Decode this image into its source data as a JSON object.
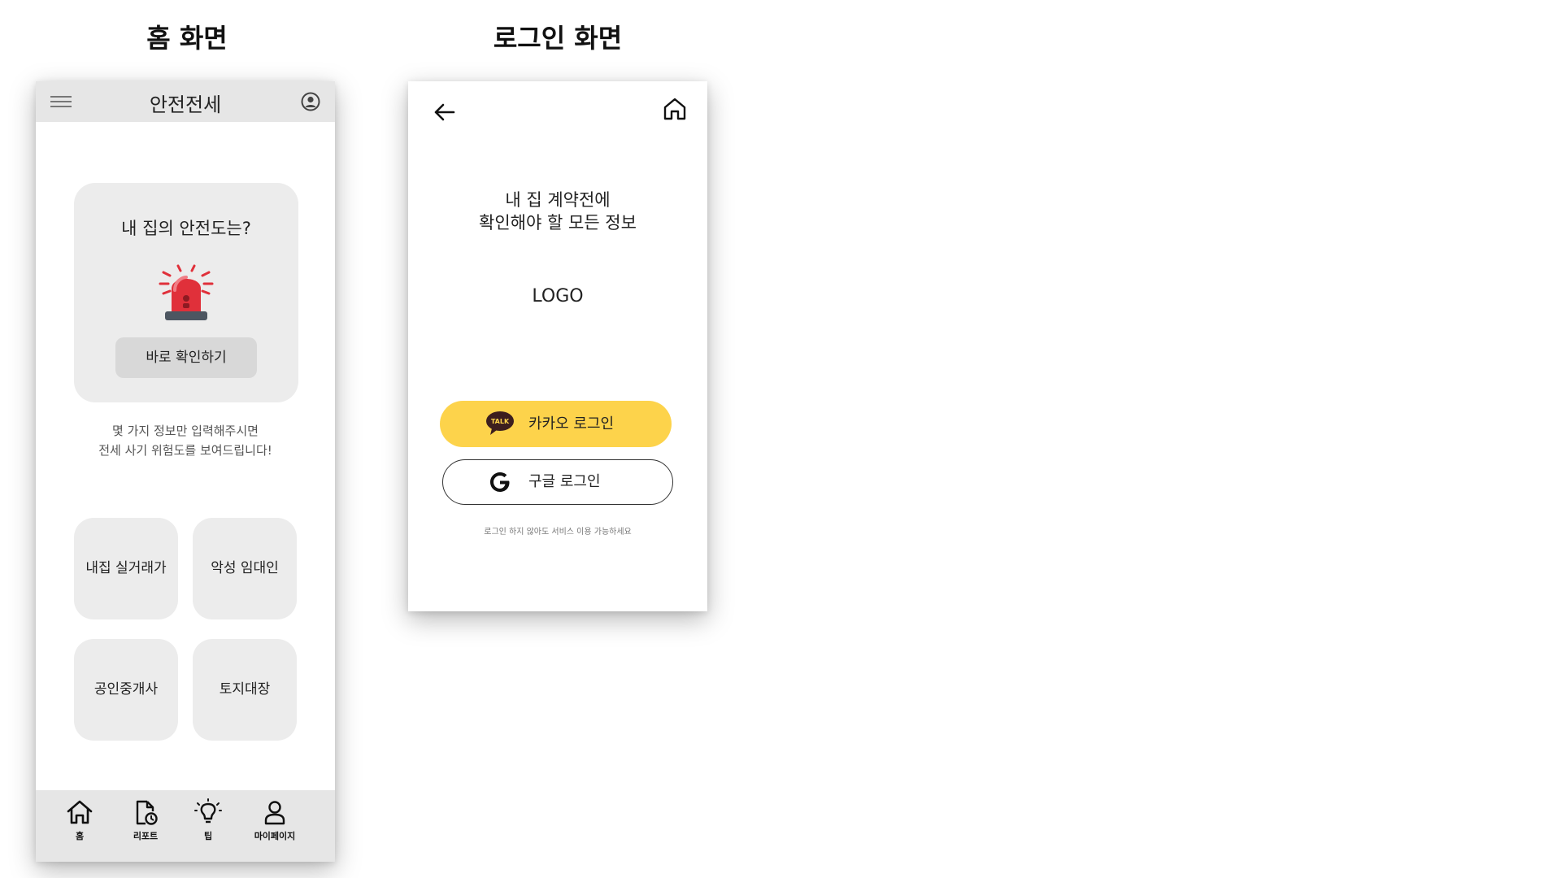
{
  "captions": {
    "home": "홈 화면",
    "login": "로그인 화면"
  },
  "home": {
    "title": "안전전세",
    "card_question": "내 집의 안전도는?",
    "check_button": "바로 확인하기",
    "description": [
      "몇 가지 정보만 입력해주시면",
      "전세 사기 위험도를 보여드립니다!"
    ],
    "tiles": [
      "내집 실거래가",
      "악성 임대인",
      "공인중개사",
      "토지대장"
    ],
    "nav": [
      "홈",
      "리포트",
      "팁",
      "마이페이지"
    ],
    "icons": [
      "menu-icon",
      "profile-icon",
      "siren-icon",
      "home-icon",
      "report-icon",
      "lightbulb-icon",
      "user-icon"
    ]
  },
  "login": {
    "tagline_line1": "내 집 계약전에",
    "tagline_line2": "확인해야 할 모든 정보",
    "logo": "LOGO",
    "kakao_button": "카카오 로그인",
    "kakao_badge": "TALK",
    "google_button": "구글 로그인",
    "note": "로그인 하지 않아도 서비스 이용 가능하세요",
    "icons": [
      "back-arrow-icon",
      "home-icon",
      "kakao-talk-icon",
      "google-g-icon"
    ]
  },
  "colors": {
    "kakao_yellow": "#fdd34b",
    "siren_red": "#e0303a",
    "panel_gray": "#ececec",
    "bar_gray": "#e6e6e6"
  }
}
